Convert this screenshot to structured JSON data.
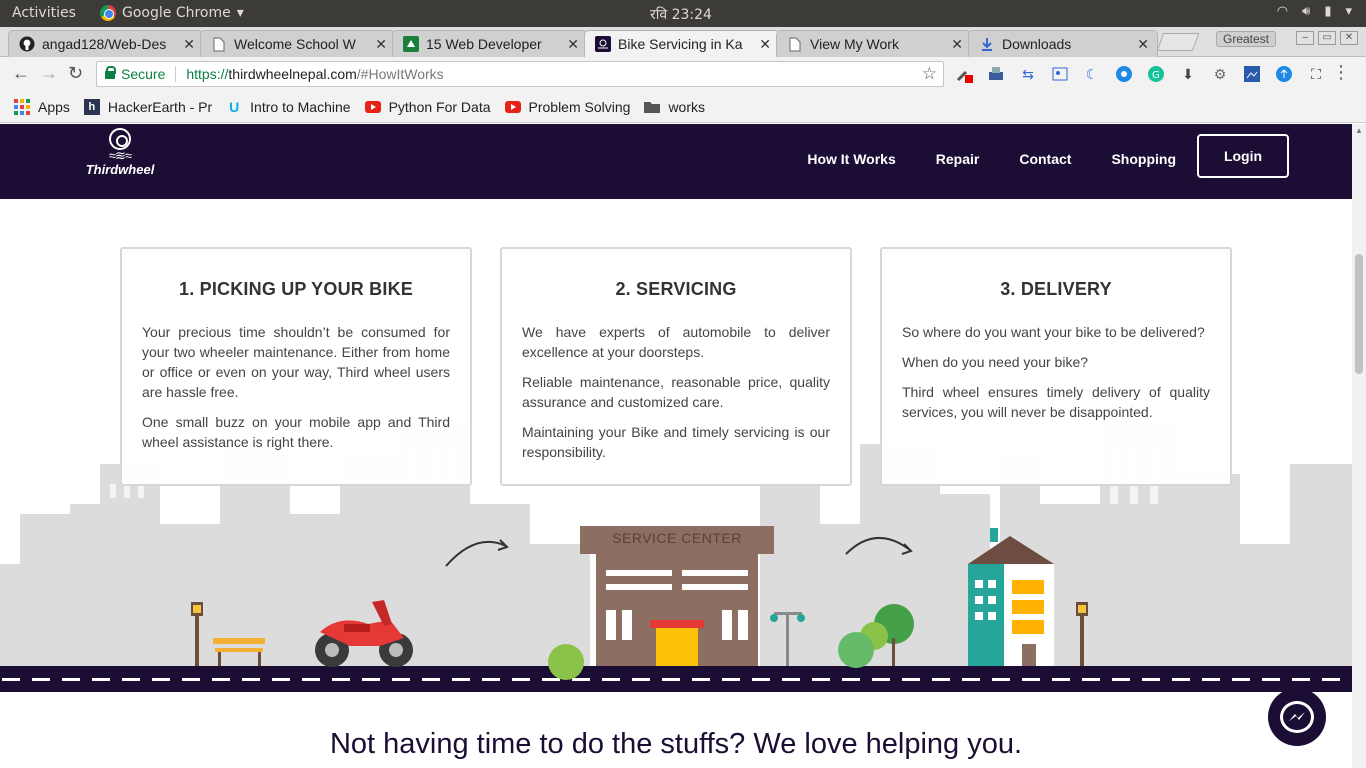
{
  "system_bar": {
    "activities": "Activities",
    "app_name": "Google Chrome",
    "clock": "रवि  23:24"
  },
  "tabs": [
    {
      "title": "angad128/Web-Des",
      "icon": "github-icon"
    },
    {
      "title": "Welcome School W",
      "icon": "page-icon"
    },
    {
      "title": "15 Web Developer",
      "icon": "site-icon"
    },
    {
      "title": "Bike Servicing in Ka",
      "icon": "site-icon",
      "active": true
    },
    {
      "title": "View My Work",
      "icon": "page-icon"
    },
    {
      "title": "Downloads",
      "icon": "download-icon"
    }
  ],
  "window": {
    "profile_label": "Greatest"
  },
  "omnibox": {
    "secure_label": "Secure",
    "url_scheme": "https://",
    "url_host": "thirdwheelnepal.com",
    "url_path": "/#HowItWorks"
  },
  "bookmarks": [
    {
      "label": "Apps",
      "icon": "apps-grid-icon"
    },
    {
      "label": "HackerEarth - Pr",
      "icon": "hackerearth-icon"
    },
    {
      "label": "Intro to Machine",
      "icon": "udacity-icon"
    },
    {
      "label": "Python For Data",
      "icon": "youtube-icon"
    },
    {
      "label": "Problem Solving",
      "icon": "youtube-icon"
    },
    {
      "label": "works",
      "icon": "folder-icon"
    }
  ],
  "site": {
    "logo_text": "Thirdwheel",
    "nav": [
      "How It Works",
      "Repair",
      "Contact",
      "Shopping"
    ],
    "login": "Login",
    "service_center_sign": "SERVICE CENTER",
    "cards": [
      {
        "title": "1. PICKING UP YOUR BIKE",
        "paragraphs": [
          "Your precious time shouldn’t be consumed for your two wheeler maintenance. Either from home or office or even on your way, Third wheel users are hassle free.",
          "One small buzz on your mobile app and Third wheel assistance is right there."
        ]
      },
      {
        "title": "2. SERVICING",
        "paragraphs": [
          "We have experts of automobile to deliver excellence at your doorsteps.",
          "Reliable maintenance, reasonable price, quality assurance and customized care.",
          "Maintaining your Bike and timely servicing is our responsibility."
        ]
      },
      {
        "title": "3. DELIVERY",
        "paragraphs": [
          "So where do you want your bike to be delivered?",
          "When do you need your bike?",
          "Third wheel ensures timely delivery of quality services, you will never be disappointed."
        ]
      }
    ],
    "tagline": "Not having time to do the stuffs? We love helping you."
  },
  "colors": {
    "brand_dark": "#1b0d33",
    "secure_green": "#0b8043"
  }
}
